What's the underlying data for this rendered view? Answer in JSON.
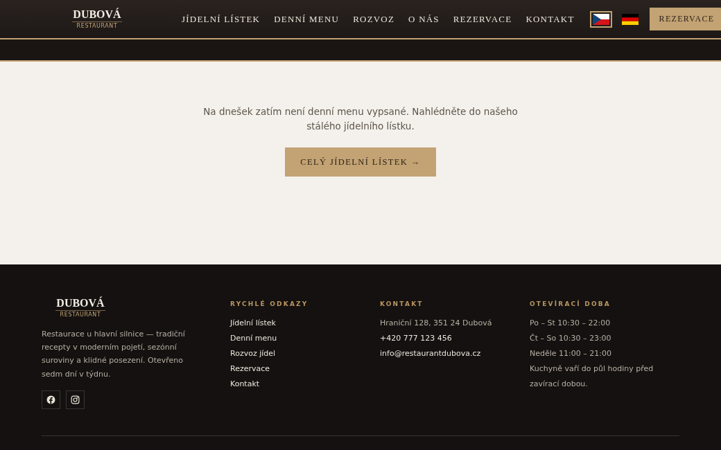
{
  "header": {
    "logo": {
      "name": "DUBOVÁ",
      "tagline": "RESTAURANT"
    },
    "nav": [
      {
        "label": "JÍDELNÍ LÍSTEK"
      },
      {
        "label": "DENNÍ MENU"
      },
      {
        "label": "ROZVOZ"
      },
      {
        "label": "O NÁS"
      },
      {
        "label": "REZERVACE"
      },
      {
        "label": "KONTAKT"
      }
    ],
    "languages": [
      {
        "kind": "cz",
        "selected": true
      },
      {
        "kind": "de",
        "selected": false
      }
    ],
    "cta": "REZERVACE"
  },
  "notice": {
    "text": "Na dnešek zatím není denní menu vypsané. Nahlédněte do našeho stálého jídelního lístku.",
    "button": "CELÝ JÍDELNÍ LÍSTEK →"
  },
  "footer": {
    "logo": {
      "name": "DUBOVÁ",
      "tagline": "RESTAURANT"
    },
    "about": "Restaurace u hlavní silnice — tradiční recepty v moderním pojetí, sezónní suroviny a klidné posezení. Otevřeno sedm dní v týdnu.",
    "social": [
      {
        "kind": "facebook"
      },
      {
        "kind": "instagram"
      }
    ],
    "columns": [
      {
        "heading": "RYCHLÉ ODKAZY",
        "kind": "links",
        "items": [
          "Jídelní lístek",
          "Denní menu",
          "Rozvoz jídel",
          "Rezervace",
          "Kontakt"
        ]
      },
      {
        "heading": "KONTAKT",
        "kind": "contact",
        "items": [
          "Hraniční 128, 351 24 Dubová",
          "+420 777 123 456",
          "info@restaurantdubova.cz"
        ]
      },
      {
        "heading": "OTEVÍRACÍ DOBA",
        "kind": "text",
        "items": [
          "Po – St 10:30 – 22:00",
          "Čt – So 10:30 – 23:00",
          "Neděle 11:00 – 21:00",
          "Kuchyně vaří do půl hodiny před zavírací dobou."
        ]
      }
    ]
  }
}
